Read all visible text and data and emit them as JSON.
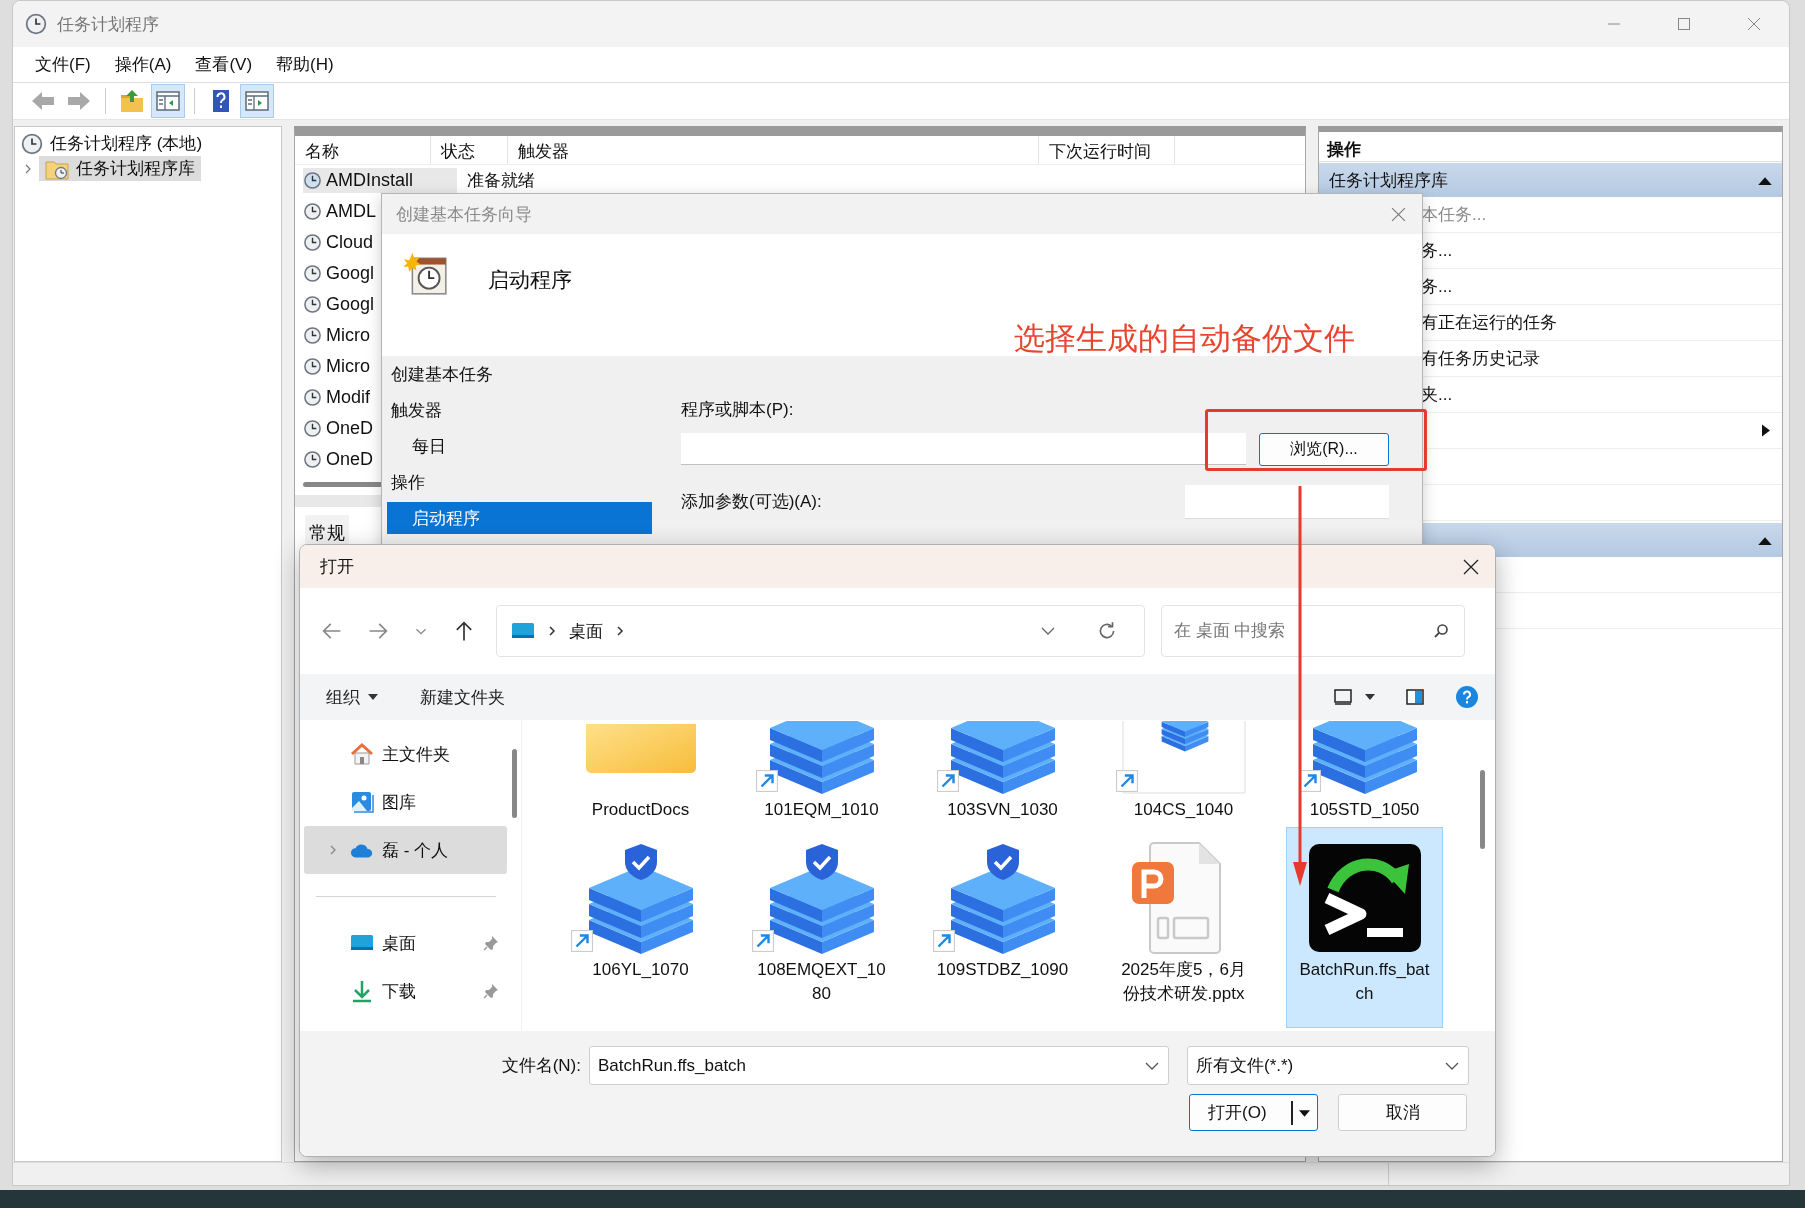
{
  "window": {
    "title": "任务计划程序"
  },
  "menu": [
    "文件(F)",
    "操作(A)",
    "查看(V)",
    "帮助(H)"
  ],
  "toolbar": [
    {
      "kind": "back",
      "disabled": true,
      "pressed": false
    },
    {
      "kind": "forward",
      "disabled": true,
      "pressed": false
    },
    {
      "kind": "up-folder",
      "disabled": false,
      "pressed": false
    },
    {
      "kind": "tree-pane",
      "disabled": false,
      "pressed": true
    },
    {
      "kind": "help",
      "disabled": false,
      "pressed": false
    },
    {
      "kind": "action-pane",
      "disabled": false,
      "pressed": true
    }
  ],
  "tree": [
    {
      "label": "任务计划程序 (本地)",
      "selected": false,
      "children": [
        {
          "label": "任务计划程序库",
          "selected": true,
          "expanded": false
        }
      ]
    }
  ],
  "task_list": {
    "columns": [
      "名称",
      "状态",
      "触发器",
      "下次运行时间"
    ],
    "rows": [
      {
        "name": "AMDInstall",
        "status": "准备就绪",
        "selected": true
      },
      {
        "name": "AMDL",
        "selected": false
      },
      {
        "name": "Cloud",
        "selected": false
      },
      {
        "name": "Googl",
        "selected": false
      },
      {
        "name": "Googl",
        "selected": false
      },
      {
        "name": "Micro",
        "selected": false
      },
      {
        "name": "Micro",
        "selected": false
      },
      {
        "name": "Modif",
        "selected": false
      },
      {
        "name": "OneD",
        "selected": false
      },
      {
        "name": "OneD",
        "selected": false
      }
    ],
    "lower_tab": "常规"
  },
  "actions_panel": {
    "title": "操作",
    "sections": [
      {
        "title": "任务计划程序库",
        "expanded": true,
        "items": [
          {
            "kind": "command",
            "label": "本任务...",
            "disabled": true
          },
          {
            "kind": "command",
            "label": "务...",
            "disabled": false
          },
          {
            "kind": "command",
            "label": "务...",
            "disabled": false
          },
          {
            "kind": "command",
            "label": "有正在运行的任务",
            "disabled": false
          },
          {
            "kind": "command",
            "label": "有任务历史记录",
            "disabled": false
          },
          {
            "kind": "command",
            "label": "夹...",
            "disabled": false
          },
          {
            "kind": "submenu"
          }
        ]
      },
      {
        "expanded": true
      }
    ]
  },
  "wizard": {
    "title": "创建基本任务向导",
    "heading": "启动程序",
    "steps": [
      {
        "kind": "group",
        "label": "创建基本任务",
        "selected": false
      },
      {
        "kind": "group",
        "label": "触发器",
        "selected": false
      },
      {
        "kind": "step",
        "label": "每日",
        "selected": false
      },
      {
        "kind": "group",
        "label": "操作",
        "selected": false
      },
      {
        "kind": "step",
        "label": "启动程序",
        "selected": true
      }
    ],
    "program_label": "程序或脚本(P):",
    "browse_button": "浏览(R)...",
    "args_label": "添加参数(可选)(A):"
  },
  "annotation": {
    "text": "选择生成的自动备份文件"
  },
  "open_dialog": {
    "title": "打开",
    "path": [
      "桌面"
    ],
    "search_placeholder": "在 桌面 中搜索",
    "commands": [
      {
        "label": "组织",
        "dropdown": true
      },
      {
        "label": "新建文件夹",
        "dropdown": false
      }
    ],
    "nav": [
      {
        "kind": "home",
        "label": "主文件夹",
        "selected": false
      },
      {
        "kind": "gallery",
        "label": "图库",
        "selected": false
      },
      {
        "kind": "cloud",
        "label": "磊 - 个人",
        "selected": true,
        "expanded": false
      }
    ],
    "pinned": [
      {
        "kind": "desktop",
        "label": "桌面",
        "selected": false
      },
      {
        "kind": "download",
        "label": "下载",
        "selected": false
      }
    ],
    "files": [
      {
        "name": "ProductDocs",
        "kind": "folder",
        "shortcut": false,
        "selected": false
      },
      {
        "name": "101EQM_1010",
        "kind": "server",
        "shortcut": true,
        "selected": false
      },
      {
        "name": "103SVN_1030",
        "kind": "server",
        "shortcut": true,
        "selected": false
      },
      {
        "name": "104CS_1040",
        "kind": "server-thumb",
        "shortcut": true,
        "selected": false
      },
      {
        "name": "105STD_1050",
        "kind": "server",
        "shortcut": true,
        "selected": false
      },
      {
        "name": "106YL_1070",
        "kind": "server-shield",
        "shortcut": true,
        "selected": false
      },
      {
        "name": "108EMQEXT_1080",
        "kind": "server-shield",
        "shortcut": true,
        "selected": false
      },
      {
        "name": "109STDBZ_1090",
        "kind": "server-shield",
        "shortcut": true,
        "selected": false
      },
      {
        "name": "2025年度5，6月份技术研发.pptx",
        "kind": "pptx",
        "shortcut": false,
        "selected": false
      },
      {
        "name": "BatchRun.ffs_batch",
        "kind": "batch",
        "shortcut": false,
        "selected": true
      }
    ],
    "filename_label": "文件名(N):",
    "filename": "BatchRun.ffs_batch",
    "filter": "所有文件(*.*)",
    "open_button": "打开(O)",
    "cancel_button": "取消"
  }
}
